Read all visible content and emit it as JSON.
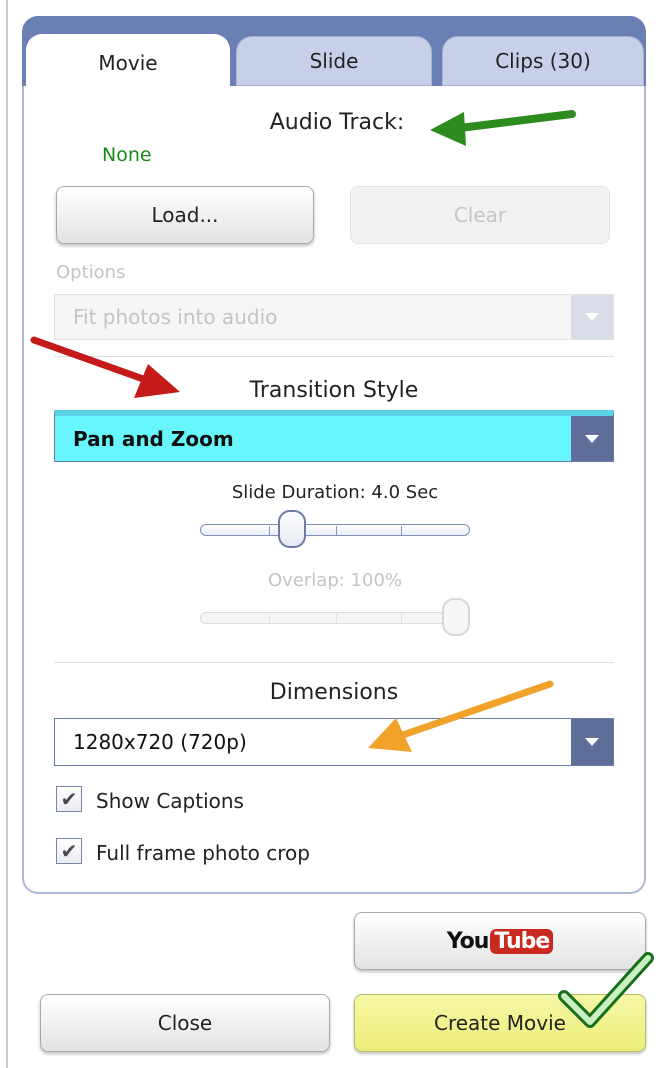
{
  "tabs": [
    {
      "label": "Movie",
      "active": true
    },
    {
      "label": "Slide",
      "active": false
    },
    {
      "label": "Clips (30)",
      "active": false
    }
  ],
  "audio": {
    "heading": "Audio Track:",
    "current": "None",
    "load_label": "Load...",
    "clear_label": "Clear",
    "options_label": "Options",
    "options_value": "Fit photos into audio"
  },
  "transition": {
    "heading": "Transition Style",
    "value": "Pan and Zoom",
    "duration_label": "Slide Duration: 4.0 Sec",
    "duration_seconds": 4.0,
    "overlap_label": "Overlap: 100%",
    "overlap_percent": 100
  },
  "dimensions": {
    "heading": "Dimensions",
    "value": "1280x720 (720p)"
  },
  "checkboxes": [
    {
      "label": "Show Captions",
      "checked": true
    },
    {
      "label": "Full frame photo crop",
      "checked": true
    }
  ],
  "footer": {
    "youtube_you": "You",
    "youtube_tube": "Tube",
    "close_label": "Close",
    "create_label": "Create Movie"
  },
  "icons": {
    "dropdown": "chevron-down-icon",
    "check": "checkmark-icon",
    "annotations": [
      "green-arrow",
      "red-arrow",
      "orange-arrow",
      "green-checkmark"
    ]
  },
  "colors": {
    "tab_bar": "#6a7fb3",
    "audio_none": "#1a8a1a",
    "transition_highlight": "#66f6fb",
    "dropdown_caret_bg": "#5f6e99",
    "create_button": "#f1f38a",
    "youtube_red": "#c82a1f"
  }
}
